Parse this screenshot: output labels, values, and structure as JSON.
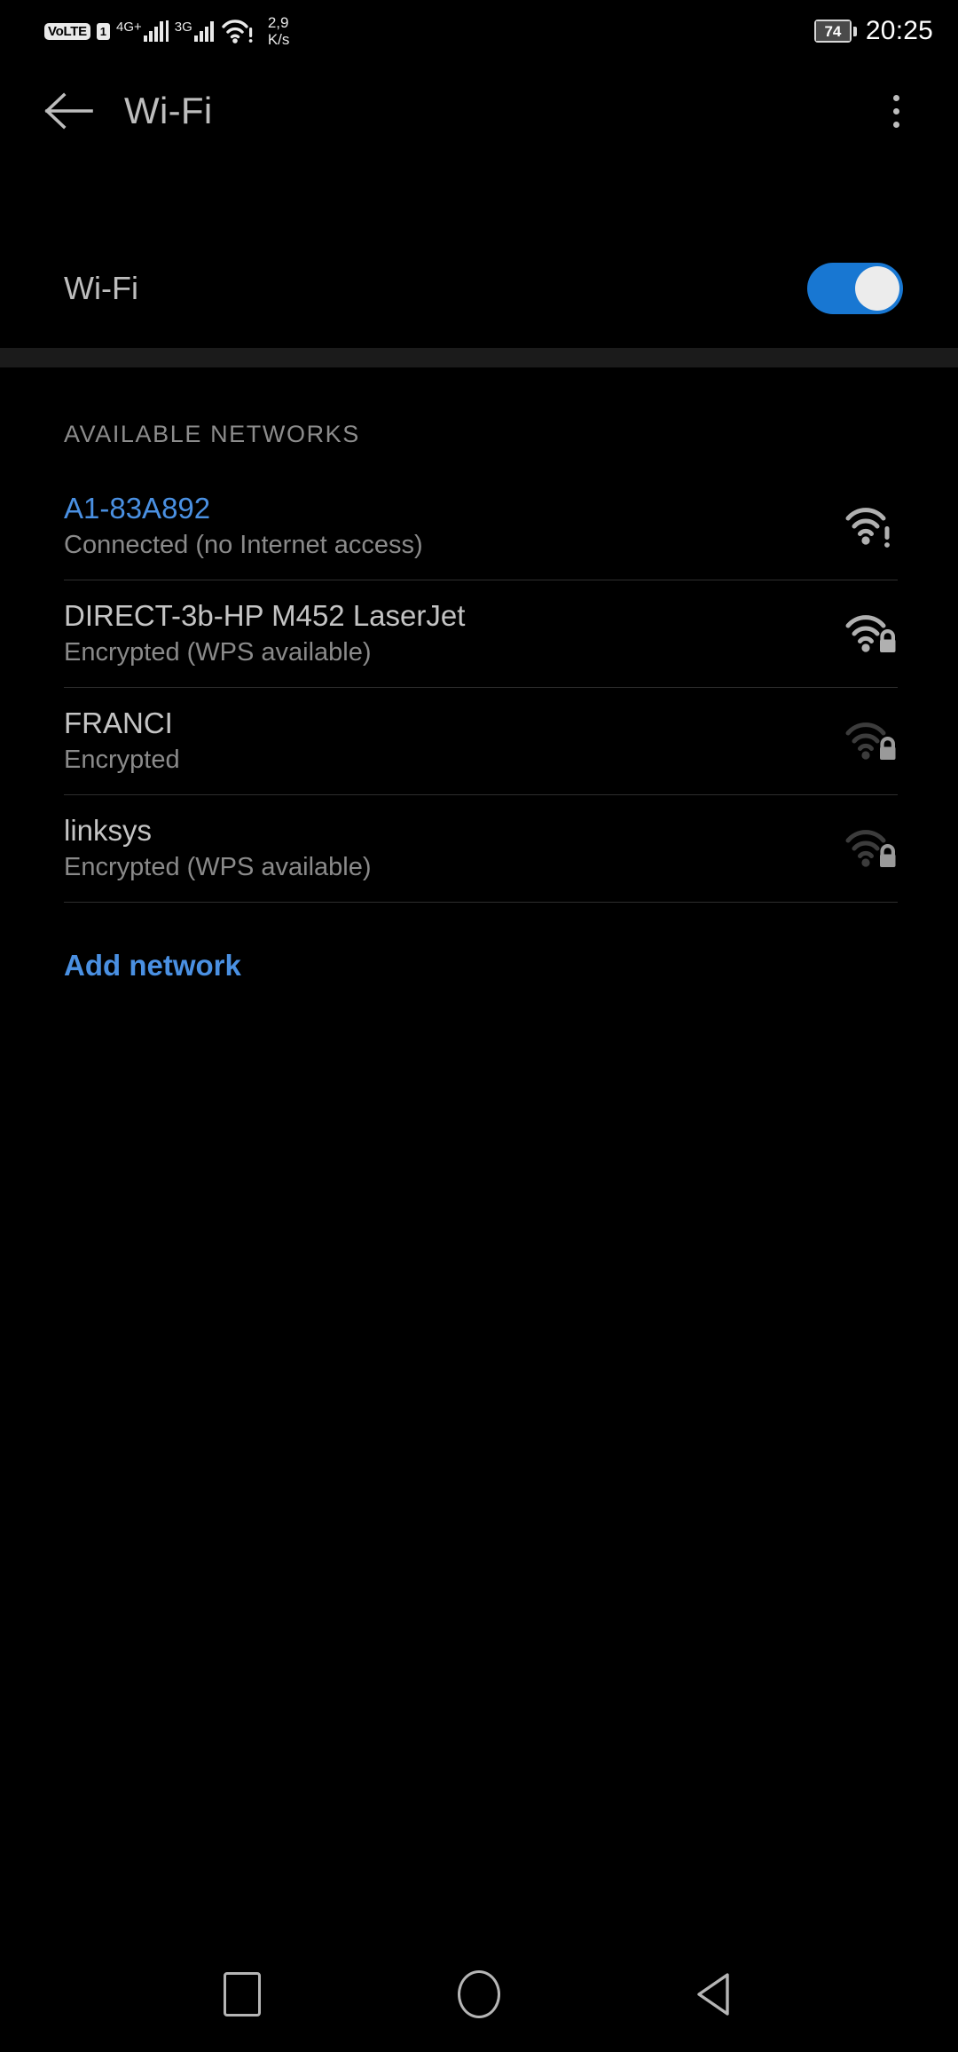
{
  "status_bar": {
    "volte_label": "VoLTE",
    "sim_label": "1",
    "network_primary": "4G+",
    "network_secondary": "3G",
    "wifi_icon": "wifi-alert-icon",
    "data_rate": "2,9\nK/s",
    "battery_level": "74",
    "clock": "20:25"
  },
  "app_bar": {
    "back_icon": "arrow-left-icon",
    "title": "Wi-Fi",
    "overflow_icon": "more-vertical-icon"
  },
  "master_toggle": {
    "label": "Wi-Fi",
    "state": "on",
    "accent_color": "#1877d2"
  },
  "networks_section": {
    "header": "AVAILABLE NETWORKS",
    "items": [
      {
        "ssid": "A1-83A892",
        "status": "Connected (no Internet access)",
        "connected": true,
        "icon": "wifi-signal-alert-icon",
        "signal": "full",
        "secured": false
      },
      {
        "ssid": "DIRECT-3b-HP M452 LaserJet",
        "status": "Encrypted (WPS available)",
        "connected": false,
        "icon": "wifi-signal-lock-icon",
        "signal": "full",
        "secured": true
      },
      {
        "ssid": "FRANCI",
        "status": "Encrypted",
        "connected": false,
        "icon": "wifi-signal-lock-icon",
        "signal": "weak",
        "secured": true
      },
      {
        "ssid": "linksys",
        "status": "Encrypted (WPS available)",
        "connected": false,
        "icon": "wifi-signal-lock-icon",
        "signal": "weak",
        "secured": true
      }
    ],
    "add_network_label": "Add network",
    "link_color": "#4a90e2"
  },
  "nav_bar": {
    "recents_icon": "square-icon",
    "home_icon": "circle-icon",
    "back_icon": "triangle-left-icon"
  }
}
